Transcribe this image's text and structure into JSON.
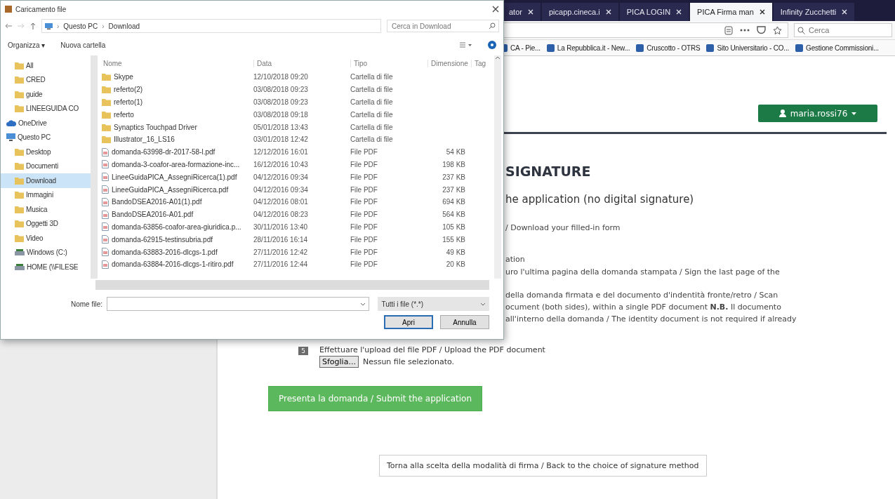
{
  "browser": {
    "tabs": [
      {
        "label": "ator",
        "selected": false
      },
      {
        "label": "picapp.cineca.i",
        "selected": false
      },
      {
        "label": "PICA LOGIN",
        "selected": false
      },
      {
        "label": "PICA Firma man",
        "selected": true
      },
      {
        "label": "Infinity Zucchetti",
        "selected": false
      }
    ],
    "search": {
      "placeholder": "Cerca"
    },
    "bookmarks": [
      "CA - Pie...",
      "La Repubblica.it - New...",
      "Cruscotto - OTRS",
      "Sito Universitario - CO...",
      "Gestione Commissioni..."
    ]
  },
  "page": {
    "user_menu": "maria.rossi76",
    "heading": "SIGNATURE",
    "subheading": "he application (no digital signature)",
    "lines": [
      "/ Download your filled-in form",
      "ation",
      "uro l'ultima pagina della domanda stampata / Sign the last page of the",
      "della domanda firmata e del documento d'indentità fronte/retro / Scan",
      "ocument (both sides), within a single PDF document **N.B.** Il documento",
      "all'interno della domanda / The identity document is not required if already"
    ],
    "step": {
      "number": "5",
      "text": "Effettuare l'upload del file PDF / Upload the PDF document",
      "browse_button": "Sfoglia...",
      "file_status": "Nessun file selezionato."
    },
    "submit_button": "Presenta la domanda / Submit the application",
    "back_button": "Torna alla scelta della modalità di firma / Back to the choice of signature method"
  },
  "dialog": {
    "title": "Caricamento file",
    "breadcrumb": [
      "Questo PC",
      "Download"
    ],
    "breadcrumb_separator": "›",
    "search": {
      "placeholder": "Cerca in Download"
    },
    "toolbar": [
      "Organizza ▾",
      "Nuova cartella"
    ],
    "nav": [
      {
        "label": "All",
        "kind": "folder",
        "selected": false
      },
      {
        "label": "CRED",
        "kind": "folder",
        "selected": false
      },
      {
        "label": "guide",
        "kind": "folder",
        "selected": false
      },
      {
        "label": "LINEEGUIDA CO",
        "kind": "folder",
        "selected": false
      },
      {
        "label": "OneDrive",
        "kind": "cloud",
        "selected": false
      },
      {
        "label": "Questo PC",
        "kind": "pc",
        "selected": false
      },
      {
        "label": "Desktop",
        "kind": "folder",
        "selected": false
      },
      {
        "label": "Documenti",
        "kind": "folder",
        "selected": false
      },
      {
        "label": "Download",
        "kind": "folder",
        "selected": true
      },
      {
        "label": "Immagini",
        "kind": "folder",
        "selected": false
      },
      {
        "label": "Musica",
        "kind": "folder",
        "selected": false
      },
      {
        "label": "Oggetti 3D",
        "kind": "folder",
        "selected": false
      },
      {
        "label": "Video",
        "kind": "folder",
        "selected": false
      },
      {
        "label": "Windows (C:)",
        "kind": "drive",
        "selected": false
      },
      {
        "label": "HOME (\\\\FILESE",
        "kind": "drive",
        "selected": false
      }
    ],
    "columns": [
      "Nome",
      "Data",
      "Tipo",
      "Dimensione",
      "Tag"
    ],
    "rows": [
      {
        "kind": "folder",
        "name": "Skype",
        "date": "12/10/2018 09:20",
        "type": "Cartella di file"
      },
      {
        "kind": "folder",
        "name": "referto(2)",
        "date": "03/08/2018 09:23",
        "type": "Cartella di file"
      },
      {
        "kind": "folder",
        "name": "referto(1)",
        "date": "03/08/2018 09:23",
        "type": "Cartella di file"
      },
      {
        "kind": "folder",
        "name": "referto",
        "date": "03/08/2018 09:18",
        "type": "Cartella di file"
      },
      {
        "kind": "folder",
        "name": "Synaptics Touchpad Driver",
        "date": "05/01/2018 13:43",
        "type": "Cartella di file"
      },
      {
        "kind": "folder",
        "name": "Illustrator_16_LS16",
        "date": "03/01/2018 12:42",
        "type": "Cartella di file"
      },
      {
        "kind": "pdf",
        "name": "domanda-63998-dr-2017-58-l.pdf",
        "date": "12/12/2016 16:01",
        "type": "File PDF",
        "size": "54 KB"
      },
      {
        "kind": "pdf",
        "name": "domanda-3-coafor-area-formazione-inc...",
        "date": "16/12/2016 10:43",
        "type": "File PDF",
        "size": "198 KB"
      },
      {
        "kind": "pdf",
        "name": "LineeGuidaPICA_AssegniRicerca(1).pdf",
        "date": "04/12/2016 09:34",
        "type": "File PDF",
        "size": "237 KB"
      },
      {
        "kind": "pdf",
        "name": "LineeGuidaPICA_AssegniRicerca.pdf",
        "date": "04/12/2016 09:34",
        "type": "File PDF",
        "size": "237 KB"
      },
      {
        "kind": "pdf",
        "name": "BandoDSEA2016-A01(1).pdf",
        "date": "04/12/2016 08:01",
        "type": "File PDF",
        "size": "694 KB"
      },
      {
        "kind": "pdf",
        "name": "BandoDSEA2016-A01.pdf",
        "date": "04/12/2016 08:23",
        "type": "File PDF",
        "size": "564 KB"
      },
      {
        "kind": "pdf",
        "name": "domanda-63856-coafor-area-giuridica.p...",
        "date": "30/11/2016 13:40",
        "type": "File PDF",
        "size": "105 KB"
      },
      {
        "kind": "pdf",
        "name": "domanda-62915-testinsubria.pdf",
        "date": "28/11/2016 16:14",
        "type": "File PDF",
        "size": "155 KB"
      },
      {
        "kind": "pdf",
        "name": "domanda-63883-2016-dlcgs-1.pdf",
        "date": "27/11/2016 12:42",
        "type": "File PDF",
        "size": "49 KB"
      },
      {
        "kind": "pdf",
        "name": "domanda-63884-2016-dlcgs-1-ritiro.pdf",
        "date": "27/11/2016 12:44",
        "type": "File PDF",
        "size": "20 KB"
      }
    ],
    "filename_label": "Nome file:",
    "filter": "Tutti i file (*.*)",
    "open_button": "Apri",
    "cancel_button": "Annulla"
  }
}
